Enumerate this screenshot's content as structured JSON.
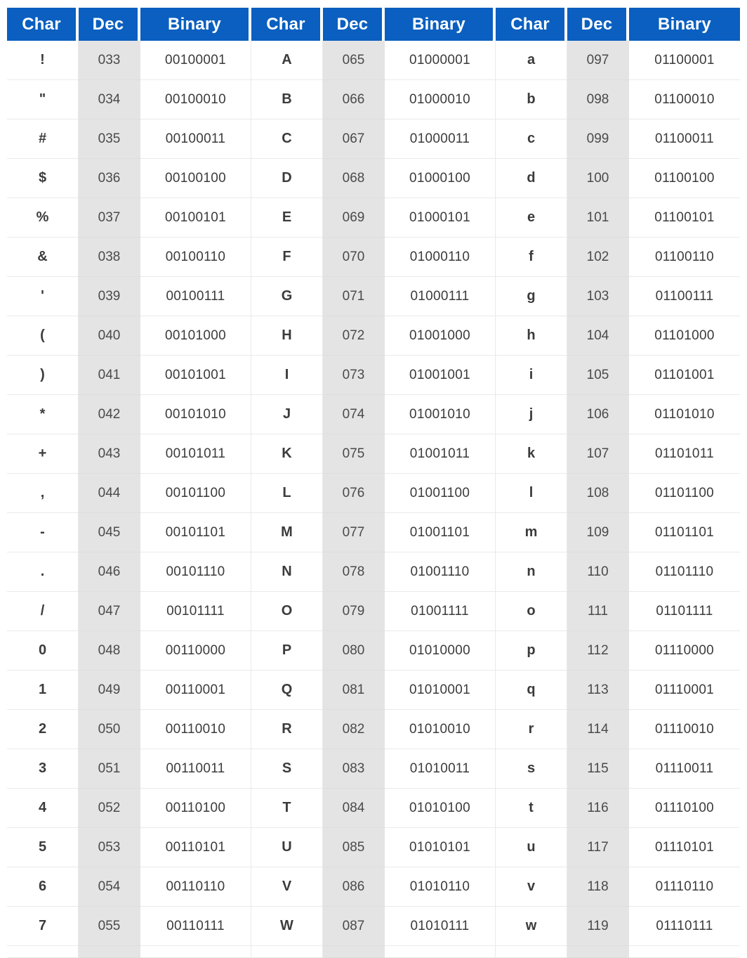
{
  "table": {
    "headers": [
      "Char",
      "Dec",
      "Binary",
      "Char",
      "Dec",
      "Binary",
      "Char",
      "Dec",
      "Binary"
    ],
    "header_bg": "#0a5fc0",
    "header_fg": "#ffffff",
    "dec_column_bg": "#e4e4e4",
    "grid_color": "#eaeaea",
    "rows": [
      [
        "!",
        "033",
        "00100001",
        "A",
        "065",
        "01000001",
        "a",
        "097",
        "01100001"
      ],
      [
        "\"",
        "034",
        "00100010",
        "B",
        "066",
        "01000010",
        "b",
        "098",
        "01100010"
      ],
      [
        "#",
        "035",
        "00100011",
        "C",
        "067",
        "01000011",
        "c",
        "099",
        "01100011"
      ],
      [
        "$",
        "036",
        "00100100",
        "D",
        "068",
        "01000100",
        "d",
        "100",
        "01100100"
      ],
      [
        "%",
        "037",
        "00100101",
        "E",
        "069",
        "01000101",
        "e",
        "101",
        "01100101"
      ],
      [
        "&",
        "038",
        "00100110",
        "F",
        "070",
        "01000110",
        "f",
        "102",
        "01100110"
      ],
      [
        "'",
        "039",
        "00100111",
        "G",
        "071",
        "01000111",
        "g",
        "103",
        "01100111"
      ],
      [
        "(",
        "040",
        "00101000",
        "H",
        "072",
        "01001000",
        "h",
        "104",
        "01101000"
      ],
      [
        ")",
        "041",
        "00101001",
        "I",
        "073",
        "01001001",
        "i",
        "105",
        "01101001"
      ],
      [
        "*",
        "042",
        "00101010",
        "J",
        "074",
        "01001010",
        "j",
        "106",
        "01101010"
      ],
      [
        "+",
        "043",
        "00101011",
        "K",
        "075",
        "01001011",
        "k",
        "107",
        "01101011"
      ],
      [
        ",",
        "044",
        "00101100",
        "L",
        "076",
        "01001100",
        "l",
        "108",
        "01101100"
      ],
      [
        "-",
        "045",
        "00101101",
        "M",
        "077",
        "01001101",
        "m",
        "109",
        "01101101"
      ],
      [
        ".",
        "046",
        "00101110",
        "N",
        "078",
        "01001110",
        "n",
        "110",
        "01101110"
      ],
      [
        "/",
        "047",
        "00101111",
        "O",
        "079",
        "01001111",
        "o",
        "111",
        "01101111"
      ],
      [
        "0",
        "048",
        "00110000",
        "P",
        "080",
        "01010000",
        "p",
        "112",
        "01110000"
      ],
      [
        "1",
        "049",
        "00110001",
        "Q",
        "081",
        "01010001",
        "q",
        "113",
        "01110001"
      ],
      [
        "2",
        "050",
        "00110010",
        "R",
        "082",
        "01010010",
        "r",
        "114",
        "01110010"
      ],
      [
        "3",
        "051",
        "00110011",
        "S",
        "083",
        "01010011",
        "s",
        "115",
        "01110011"
      ],
      [
        "4",
        "052",
        "00110100",
        "T",
        "084",
        "01010100",
        "t",
        "116",
        "01110100"
      ],
      [
        "5",
        "053",
        "00110101",
        "U",
        "085",
        "01010101",
        "u",
        "117",
        "01110101"
      ],
      [
        "6",
        "054",
        "00110110",
        "V",
        "086",
        "01010110",
        "v",
        "118",
        "01110110"
      ],
      [
        "7",
        "055",
        "00110111",
        "W",
        "087",
        "01010111",
        "w",
        "119",
        "01110111"
      ],
      [
        "",
        "",
        "",
        "",
        "",
        "",
        "",
        "",
        ""
      ]
    ],
    "partial_last_row": true
  }
}
